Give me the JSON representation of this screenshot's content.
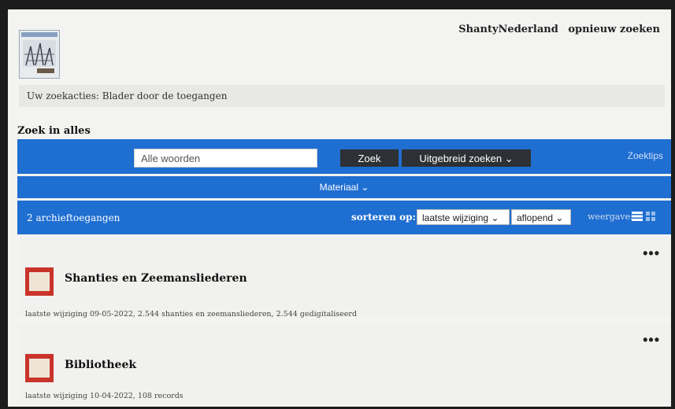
{
  "header": {
    "links": [
      "ShantyNederland",
      "opnieuw zoeken"
    ]
  },
  "breadcrumb": {
    "text": "Uw zoekacties: Blader door de toegangen"
  },
  "search": {
    "section_title": "Zoek in alles",
    "placeholder": "Alle woorden",
    "submit_label": "Zoek",
    "advanced_label": "Uitgebreid zoeken ⌄",
    "tips_label": "Zoektips"
  },
  "filter": {
    "material_label": "Materiaal ⌄"
  },
  "results_bar": {
    "count_text": "2 archieftoegangen",
    "sort_label": "sorteren op:",
    "sort_field": "laatste wijziging ⌄",
    "sort_order": "aflopend ⌄",
    "view_label": "weergave:"
  },
  "items": [
    {
      "title": "Shanties en Zeemansliederen",
      "meta": "laatste wijziging 09-05-2022, 2.544 shanties en zeemansliederen, 2.544 gedigitaliseerd",
      "menu": "•••"
    },
    {
      "title": "Bibliotheek",
      "meta": "laatste wijziging 10-04-2022, 108 records",
      "menu": "•••"
    }
  ],
  "colors": {
    "primary_blue": "#1f6ed1",
    "dark_button": "#2d3034",
    "thumb_red": "#c9342a"
  }
}
